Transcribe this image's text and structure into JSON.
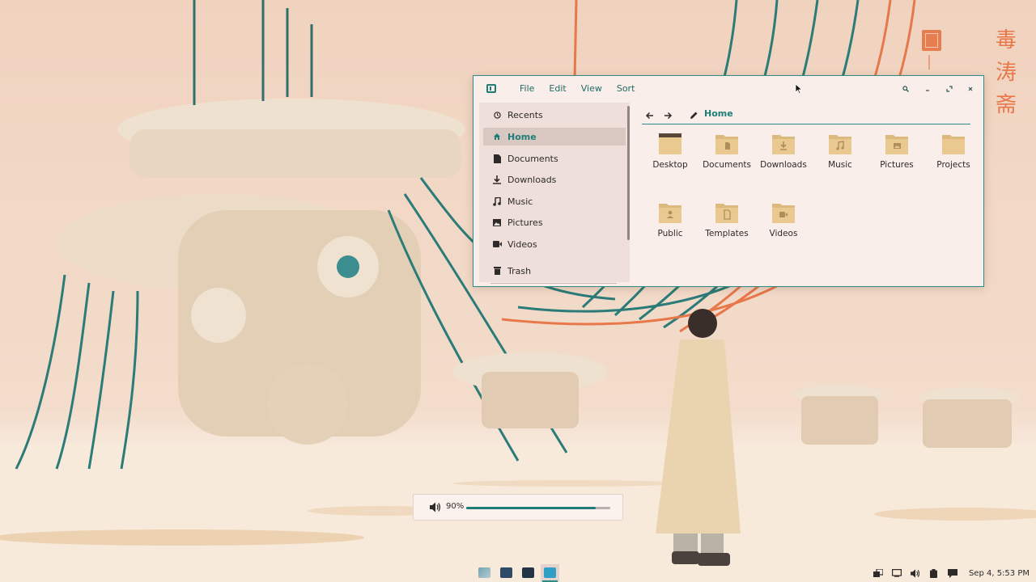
{
  "wallpaper": {
    "glyphs": [
      "毒",
      "涛",
      "斋"
    ]
  },
  "window": {
    "menu": [
      "File",
      "Edit",
      "View",
      "Sort"
    ],
    "sidebar": {
      "items": [
        {
          "label": "Recents",
          "icon": "clock-icon",
          "active": false
        },
        {
          "label": "Home",
          "icon": "home-icon",
          "active": true
        },
        {
          "label": "Documents",
          "icon": "document-icon",
          "active": false
        },
        {
          "label": "Downloads",
          "icon": "download-icon",
          "active": false
        },
        {
          "label": "Music",
          "icon": "music-icon",
          "active": false
        },
        {
          "label": "Pictures",
          "icon": "picture-icon",
          "active": false
        },
        {
          "label": "Videos",
          "icon": "video-icon",
          "active": false
        }
      ],
      "trash": {
        "label": "Trash",
        "icon": "trash-icon"
      }
    },
    "path": {
      "current": "Home"
    },
    "folders": [
      {
        "label": "Desktop",
        "icon": "desktop-folder-icon"
      },
      {
        "label": "Documents",
        "icon": "documents-folder-icon"
      },
      {
        "label": "Downloads",
        "icon": "downloads-folder-icon"
      },
      {
        "label": "Music",
        "icon": "music-folder-icon"
      },
      {
        "label": "Pictures",
        "icon": "pictures-folder-icon"
      },
      {
        "label": "Projects",
        "icon": "folder-icon"
      },
      {
        "label": "Public",
        "icon": "public-folder-icon"
      },
      {
        "label": "Templates",
        "icon": "templates-folder-icon"
      },
      {
        "label": "Videos",
        "icon": "videos-folder-icon"
      }
    ]
  },
  "volume_osd": {
    "label": "90%",
    "level": 0.9
  },
  "panel": {
    "clock": "Sep 4, 5:53 PM"
  },
  "colors": {
    "accent": "#1e7e77",
    "folder": "#e9c98f",
    "wallpaper_orange": "#e8774a"
  }
}
